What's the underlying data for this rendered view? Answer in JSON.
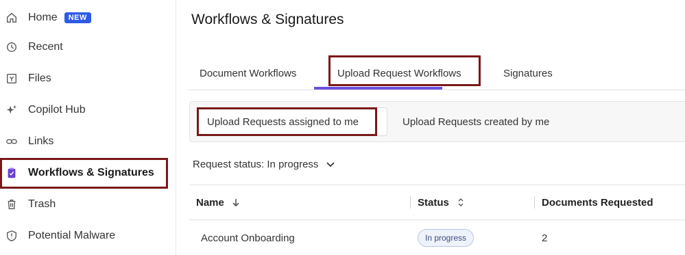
{
  "sidebar": {
    "items": [
      {
        "label": "Home",
        "icon": "home-icon",
        "badge": "NEW"
      },
      {
        "label": "Recent",
        "icon": "clock-icon"
      },
      {
        "label": "Files",
        "icon": "files-icon"
      },
      {
        "label": "Copilot Hub",
        "icon": "sparkle-icon"
      },
      {
        "label": "Links",
        "icon": "link-icon"
      },
      {
        "label": "Workflows & Signatures",
        "icon": "clipboard-icon",
        "active": true
      },
      {
        "label": "Trash",
        "icon": "trash-icon"
      },
      {
        "label": "Potential Malware",
        "icon": "shield-alert-icon"
      }
    ]
  },
  "main": {
    "title": "Workflows & Signatures",
    "tabs": [
      {
        "label": "Document Workflows"
      },
      {
        "label": "Upload Request Workflows",
        "selected": true
      },
      {
        "label": "Signatures"
      }
    ],
    "subtabs": [
      {
        "label": "Upload Requests assigned to me",
        "selected": true
      },
      {
        "label": "Upload Requests created by me"
      }
    ],
    "filter": {
      "label": "Request status: In progress"
    },
    "table": {
      "columns": [
        {
          "label": "Name",
          "sort_icon": "arrow-down-icon"
        },
        {
          "label": "Status",
          "sort_icon": "sort-updown-icon"
        },
        {
          "label": "Documents Requested"
        }
      ],
      "rows": [
        {
          "name": "Account Onboarding",
          "status": "In progress",
          "documents_requested": "2"
        }
      ]
    }
  },
  "colors": {
    "accent": "#6b4ee0",
    "badge": "#2e5be6",
    "highlight_box": "#7a1717"
  }
}
